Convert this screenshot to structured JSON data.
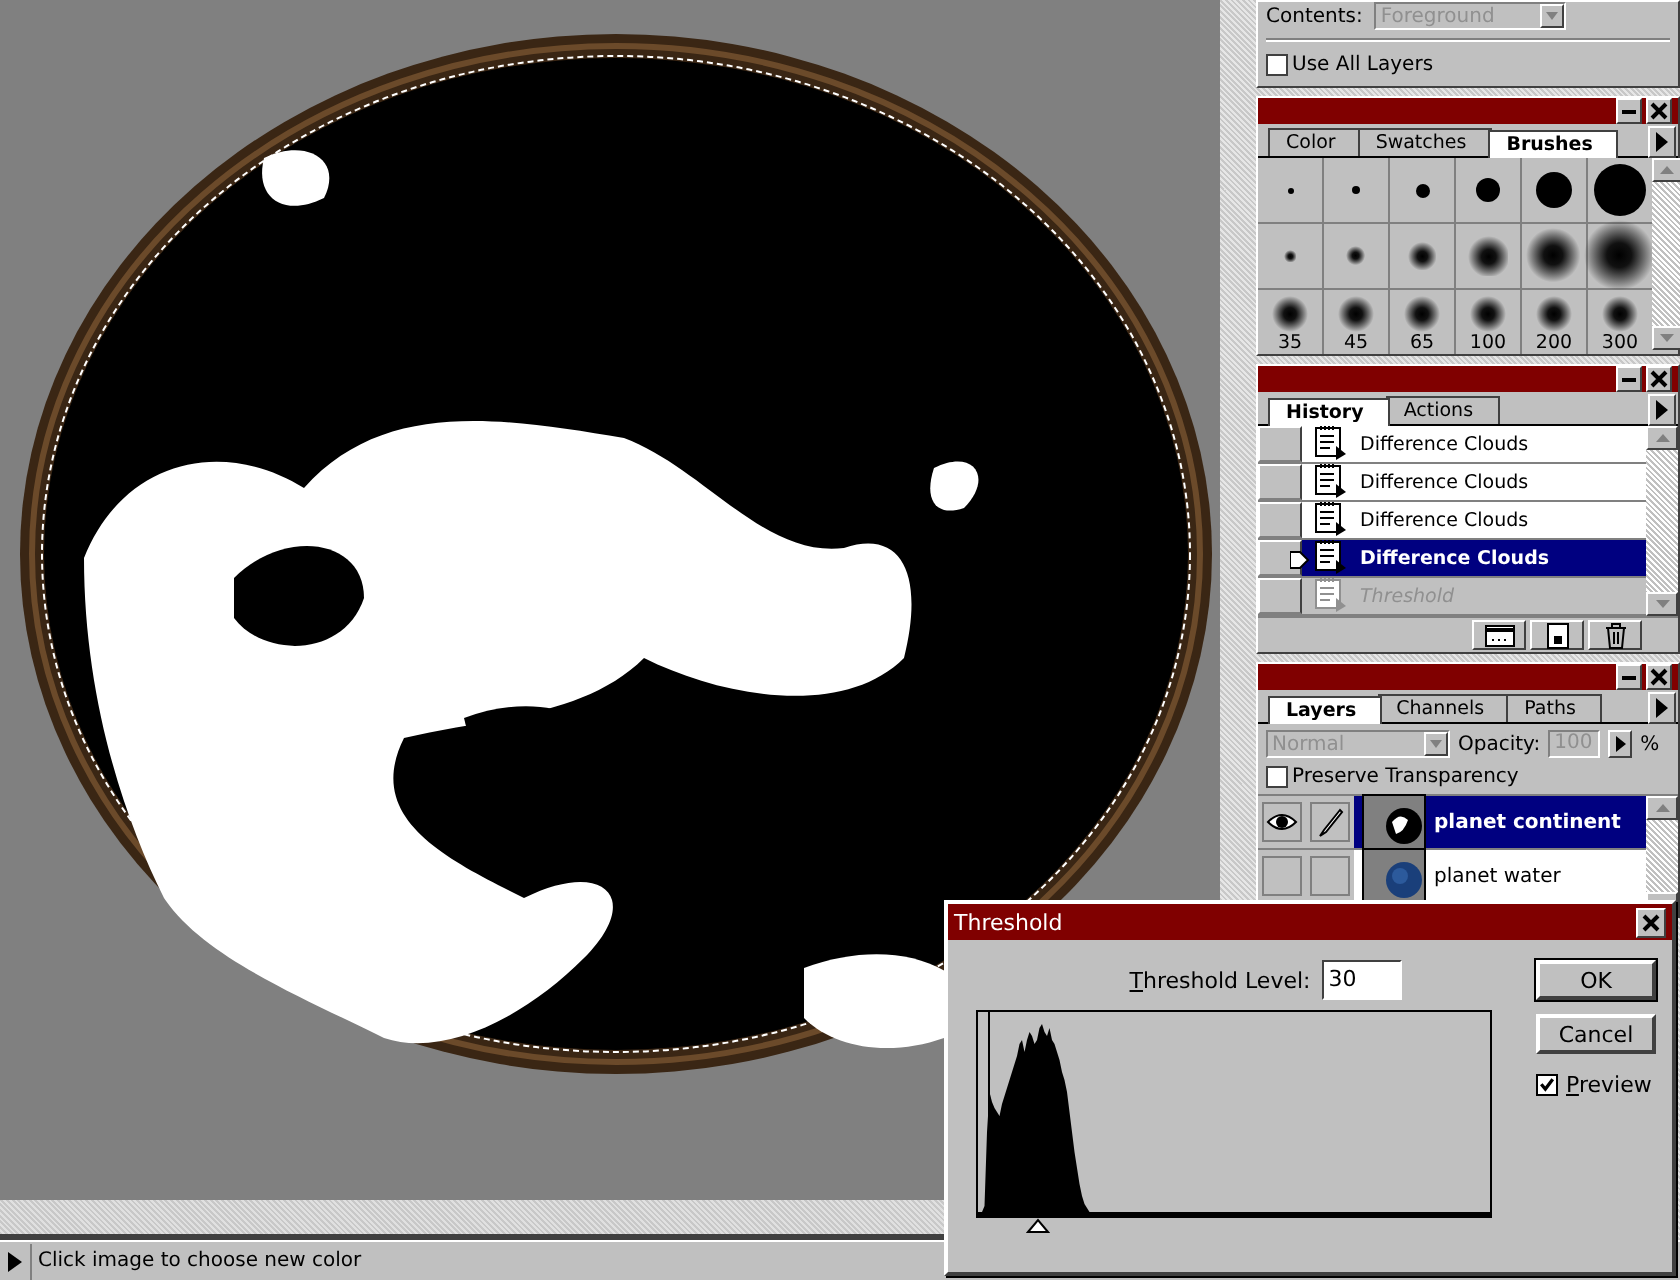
{
  "options_panel": {
    "contents_label": "Contents:",
    "contents_value": "Foreground",
    "contents_disabled": true,
    "use_all_layers": {
      "label": "Use All Layers",
      "checked": false
    }
  },
  "brushes_panel": {
    "tabs": [
      {
        "label": "Color",
        "selected": false
      },
      {
        "label": "Swatches",
        "selected": false
      },
      {
        "label": "Brushes",
        "selected": true
      }
    ],
    "brushes": [
      {
        "kind": "hard"
      },
      {
        "kind": "hard"
      },
      {
        "kind": "hard"
      },
      {
        "kind": "hard"
      },
      {
        "kind": "hard"
      },
      {
        "kind": "hard"
      },
      {
        "kind": "soft"
      },
      {
        "kind": "soft"
      },
      {
        "kind": "soft"
      },
      {
        "kind": "soft"
      },
      {
        "kind": "soft"
      },
      {
        "kind": "soft"
      },
      {
        "kind": "soft",
        "label": "35"
      },
      {
        "kind": "soft",
        "label": "45"
      },
      {
        "kind": "soft",
        "label": "65"
      },
      {
        "kind": "soft",
        "label": "100"
      },
      {
        "kind": "soft",
        "label": "200"
      },
      {
        "kind": "soft",
        "label": "300"
      }
    ]
  },
  "history_panel": {
    "tabs": [
      {
        "label": "History",
        "selected": true
      },
      {
        "label": "Actions",
        "selected": false
      }
    ],
    "items": [
      {
        "label": "Difference Clouds",
        "selected": false,
        "undone": false
      },
      {
        "label": "Difference Clouds",
        "selected": false,
        "undone": false
      },
      {
        "label": "Difference Clouds",
        "selected": false,
        "undone": false
      },
      {
        "label": "Difference Clouds",
        "selected": true,
        "undone": false
      },
      {
        "label": "Threshold",
        "selected": false,
        "undone": true
      }
    ]
  },
  "layers_panel": {
    "tabs": [
      {
        "label": "Layers",
        "selected": true
      },
      {
        "label": "Channels",
        "selected": false
      },
      {
        "label": "Paths",
        "selected": false
      }
    ],
    "blend_mode": {
      "value": "Normal",
      "disabled": true
    },
    "opacity": {
      "label": "Opacity:",
      "value": "100",
      "disabled": true
    },
    "percent": "%",
    "preserve_transparency": {
      "label": "Preserve Transparency",
      "checked": false
    },
    "layers": [
      {
        "name": "planet continent",
        "selected": true,
        "visible": true,
        "editable": true
      },
      {
        "name": "planet water",
        "selected": false,
        "visible": false,
        "editable": false
      }
    ]
  },
  "threshold_dialog": {
    "title": "Threshold",
    "level_label": "Threshold Level:",
    "level_value": "30",
    "level": 0.12,
    "buttons": [
      "OK",
      "Cancel"
    ],
    "preview": {
      "label": "Preview",
      "checked": true
    }
  },
  "status_bar": {
    "text": "Click image to choose new color"
  }
}
